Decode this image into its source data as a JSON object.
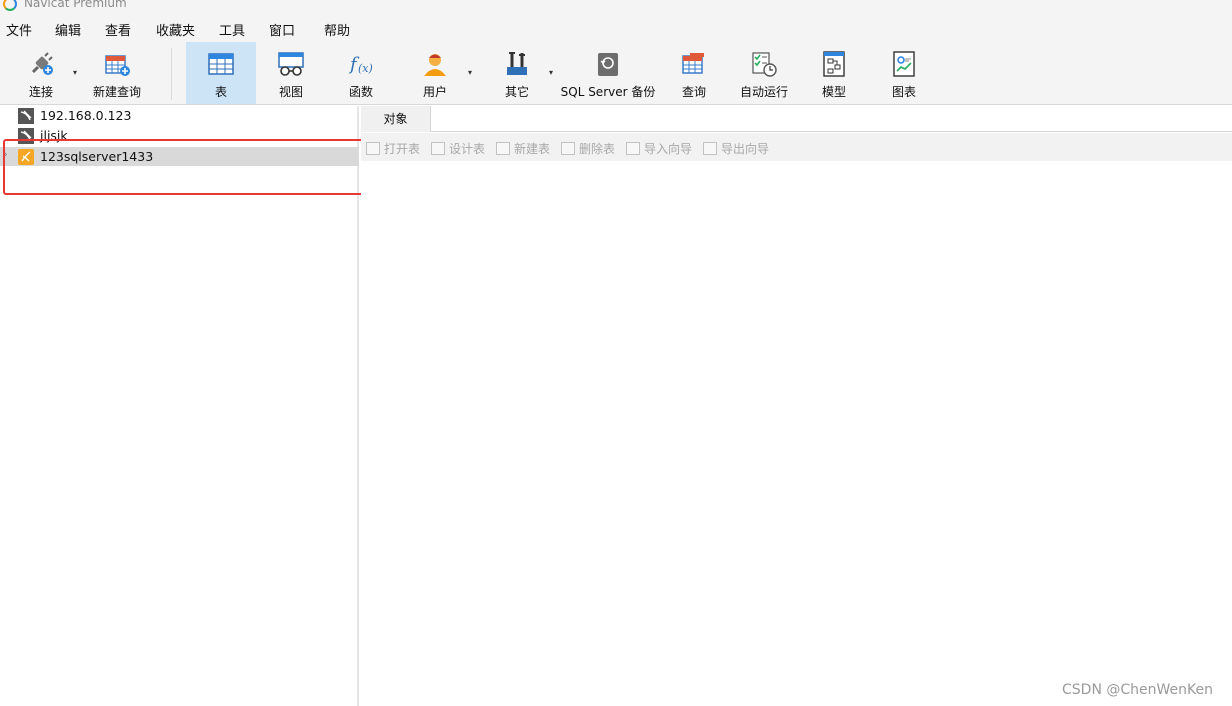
{
  "window": {
    "title": "Navicat Premium"
  },
  "menu": [
    "文件",
    "编辑",
    "查看",
    "收藏夹",
    "工具",
    "窗口",
    "帮助"
  ],
  "toolbar": {
    "connect": "连接",
    "new_query": "新建查询",
    "table": "表",
    "view": "视图",
    "function": "函数",
    "user": "用户",
    "other": "其它",
    "backup": "SQL Server 备份",
    "query": "查询",
    "automation": "自动运行",
    "model": "模型",
    "chart": "图表",
    "dropdown_glyph": "▾"
  },
  "connections": [
    {
      "label": "192.168.0.123",
      "icon": "mysql-connection-icon"
    },
    {
      "label": "jljsjk",
      "icon": "mysql-connection-icon"
    },
    {
      "label": "123sqlserver1433",
      "icon": "sqlserver-connection-icon",
      "selected": true
    }
  ],
  "tabs": {
    "objects": "对象"
  },
  "object_toolbar": {
    "open_table": "打开表",
    "design_table": "设计表",
    "new_table": "新建表",
    "delete_table": "删除表",
    "import_wizard": "导入向导",
    "export_wizard": "导出向导"
  },
  "watermark": "CSDN @ChenWenKen",
  "colors": {
    "accent": "#cde4f7",
    "highlight": "#e53935",
    "selection": "#d9d9d9"
  }
}
